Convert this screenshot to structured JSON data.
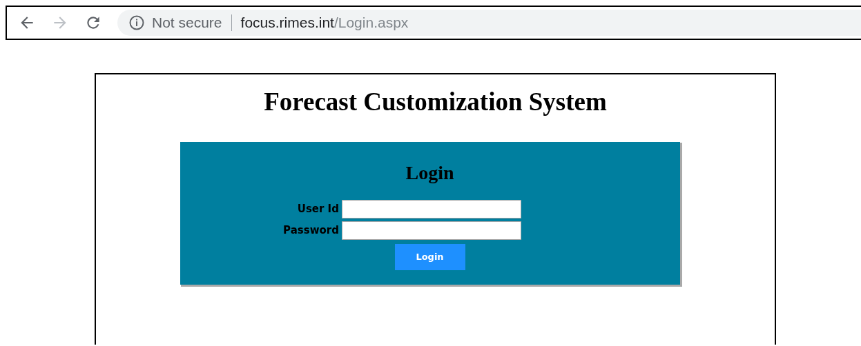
{
  "browser": {
    "security_label": "Not secure",
    "url_host": "focus.rimes.int",
    "url_path": "/Login.aspx"
  },
  "page": {
    "title": "Forecast Customization System"
  },
  "login_panel": {
    "heading": "Login",
    "fields": [
      {
        "label": "User Id"
      },
      {
        "label": "Password"
      }
    ],
    "button": "Login"
  }
}
